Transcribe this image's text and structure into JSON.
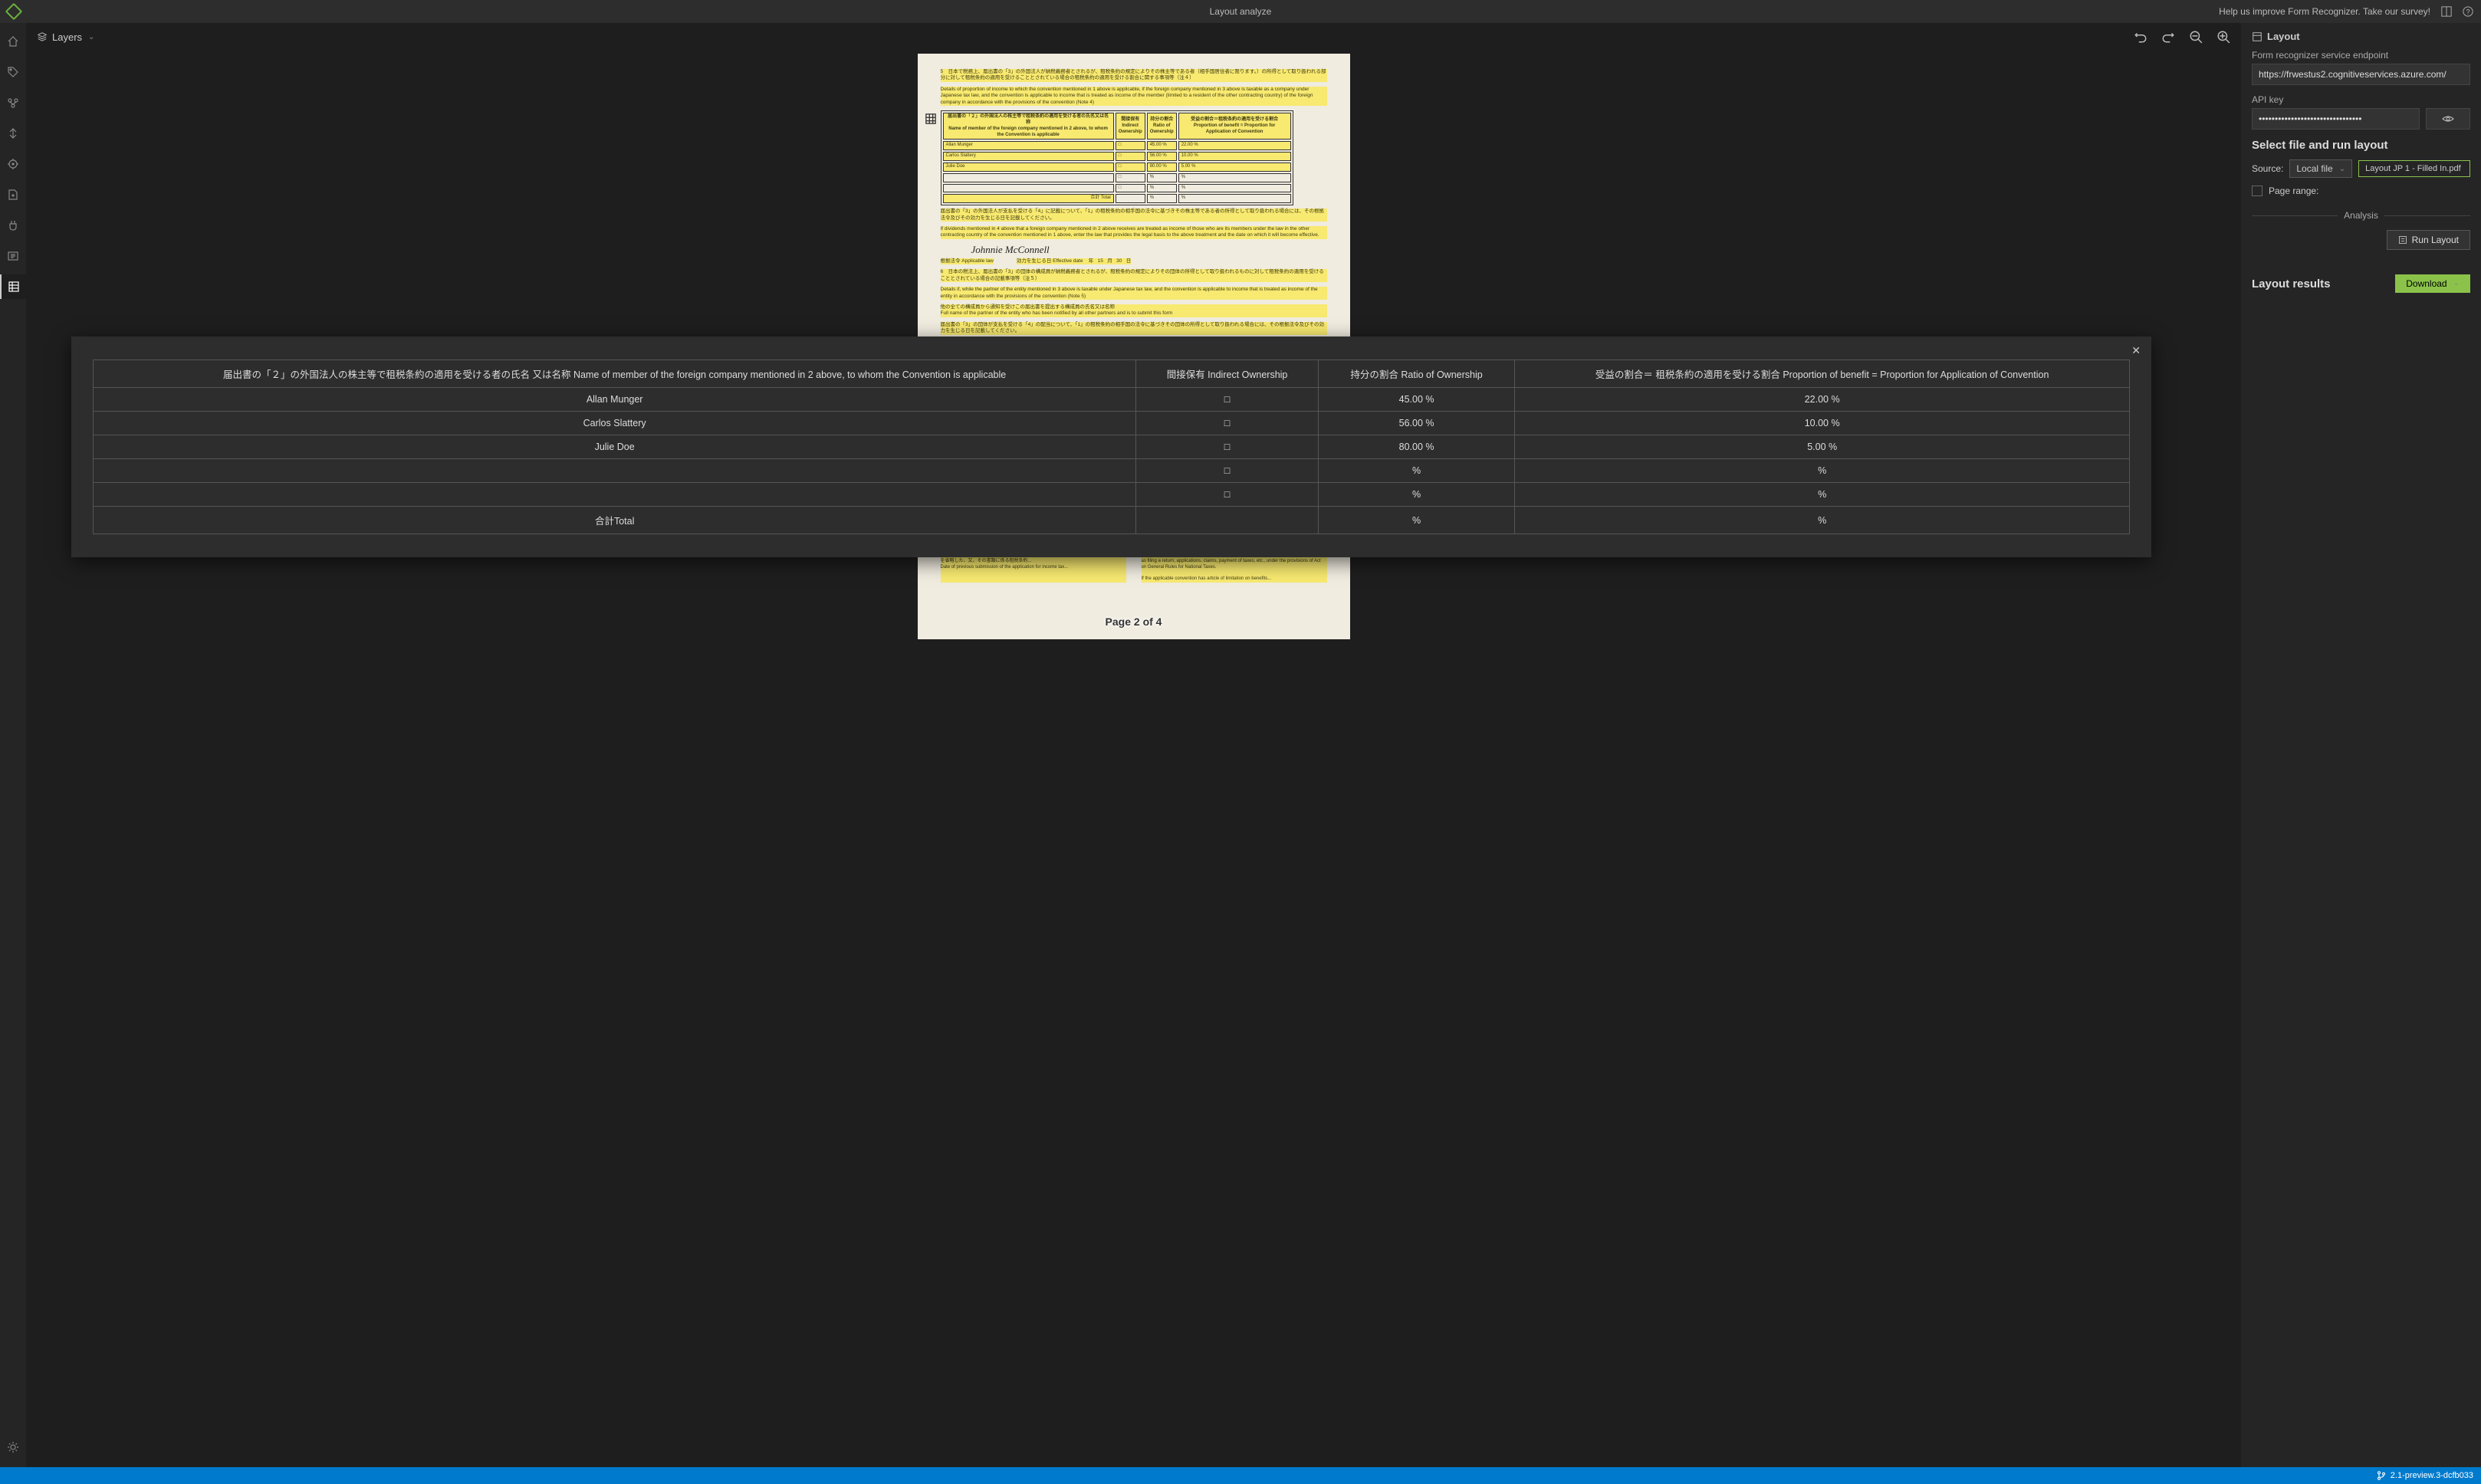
{
  "titlebar": {
    "app_title": "Layout analyze",
    "survey_link": "Help us improve Form Recognizer. Take our survey!"
  },
  "editor_toolbar": {
    "layers_label": "Layers"
  },
  "right_panel": {
    "layout_header": "Layout",
    "endpoint_label": "Form recognizer service endpoint",
    "endpoint_value": "https://frwestus2.cognitiveservices.azure.com/",
    "api_key_label": "API key",
    "api_key_value": "••••••••••••••••••••••••••••••••",
    "select_file_header": "Select file and run layout",
    "source_label": "Source:",
    "source_value": "Local file",
    "file_name": "Layout JP 1 - Filled In.pdf",
    "page_range_label": "Page range:",
    "analysis_label": "Analysis",
    "run_button": "Run Layout",
    "results_header": "Layout results",
    "download_button": "Download"
  },
  "document": {
    "page_indicator": "Page 2 of 4",
    "signature": "Johnnie McConnell",
    "preview_rows": [
      {
        "name": "Allan Munger",
        "ratio": "45.00",
        "benefit": "22.00"
      },
      {
        "name": "Carlos Slattery",
        "ratio": "56.00",
        "benefit": "10.00"
      },
      {
        "name": "Julie Doe",
        "ratio": "80.00",
        "benefit": "5.00"
      }
    ]
  },
  "modal_table": {
    "headers": {
      "col1": "届出書の「２」の外国法人の株主等で租税条約の適用を受ける者の氏名 又は名称 Name of member of the foreign company mentioned in 2 above, to whom the Convention is applicable",
      "col2": "間接保有 Indirect Ownership",
      "col3": "持分の割合 Ratio of Ownership",
      "col4": "受益の割合＝ 租税条約の適用を受ける割合 Proportion of benefit = Proportion for Application of Convention"
    },
    "rows": [
      {
        "name": "Allan Munger",
        "indirect": "□",
        "ratio": "45.00 %",
        "benefit": "22.00 %"
      },
      {
        "name": "Carlos Slattery",
        "indirect": "□",
        "ratio": "56.00 %",
        "benefit": "10.00 %"
      },
      {
        "name": "Julie Doe",
        "indirect": "□",
        "ratio": "80.00 %",
        "benefit": "5.00 %"
      },
      {
        "name": "",
        "indirect": "□",
        "ratio": "%",
        "benefit": "%"
      },
      {
        "name": "",
        "indirect": "□",
        "ratio": "%",
        "benefit": "%"
      },
      {
        "name": "合計Total",
        "indirect": "",
        "ratio": "%",
        "benefit": "%"
      }
    ]
  },
  "statusbar": {
    "version": "2.1-preview.3-dcfb033"
  }
}
